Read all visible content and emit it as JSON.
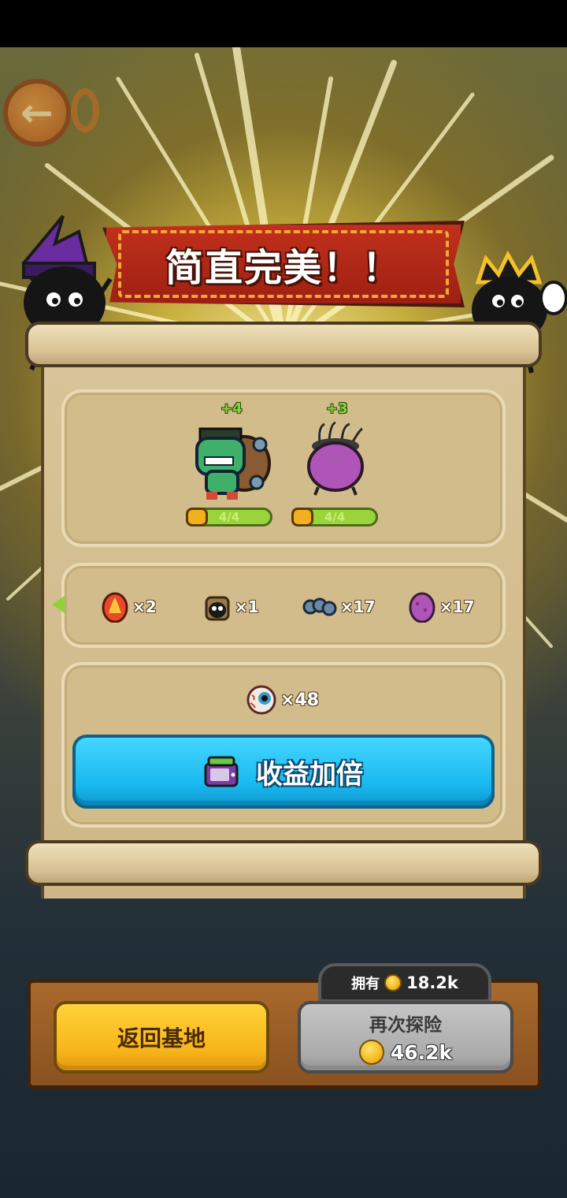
{
  "banner": {
    "title": "简直完美！！"
  },
  "rewards": {
    "monsters": [
      {
        "name": "frankenstein-monster",
        "bonus": "+4",
        "progress": "4/4"
      },
      {
        "name": "purple-egg-pod",
        "bonus": "+3",
        "progress": "4/4"
      }
    ],
    "items": [
      {
        "icon": "fire-egg-icon",
        "qty": "×2"
      },
      {
        "icon": "black-bug-icon",
        "qty": "×1"
      },
      {
        "icon": "bolt-parts-icon",
        "qty": "×17"
      },
      {
        "icon": "purple-egg-icon",
        "qty": "×17"
      }
    ],
    "eyeball": {
      "icon": "eyeball-icon",
      "qty": "×48"
    }
  },
  "double_button": {
    "label": "收益加倍",
    "icon": "tv-ad-icon"
  },
  "wallet": {
    "label": "拥有",
    "value": "18.2k"
  },
  "buttons": {
    "home": "返回基地",
    "again_label": "再次探险",
    "again_cost": "46.2k"
  },
  "colors": {
    "banner": "#b2281a",
    "double_button": "#1fbdf0",
    "home_button": "#f9bf22",
    "again_button": "#b3b3b3",
    "progress_bar": "#9ad43a"
  }
}
